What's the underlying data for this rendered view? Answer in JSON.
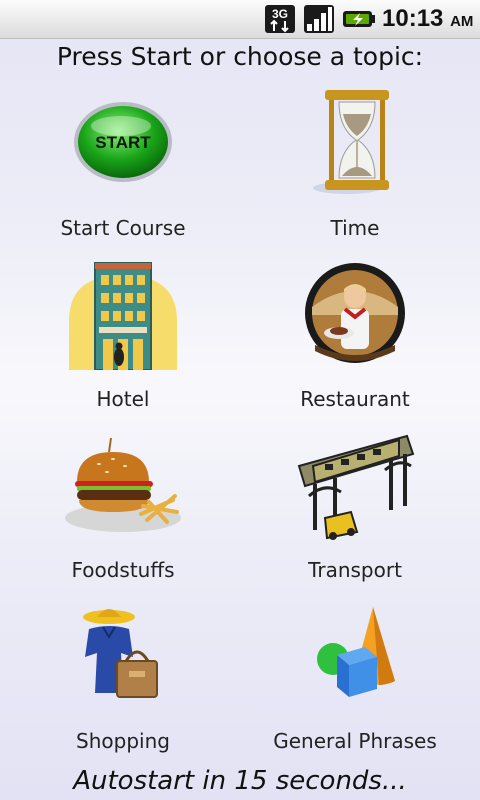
{
  "status_bar": {
    "network": "3G",
    "time": "10:13",
    "ampm": "AM",
    "icons": [
      "3g-data-icon",
      "signal-strength-icon",
      "battery-charging-icon"
    ]
  },
  "prompt": "Press Start or choose a topic:",
  "topics": [
    {
      "label": "Start Course",
      "icon": "start-button-icon"
    },
    {
      "label": "Time",
      "icon": "hourglass-icon"
    },
    {
      "label": "Hotel",
      "icon": "hotel-icon"
    },
    {
      "label": "Restaurant",
      "icon": "waiter-icon"
    },
    {
      "label": "Foodstuffs",
      "icon": "burger-fries-icon"
    },
    {
      "label": "Transport",
      "icon": "train-bridge-icon"
    },
    {
      "label": "Shopping",
      "icon": "shopping-icon"
    },
    {
      "label": "General Phrases",
      "icon": "shapes-icon"
    }
  ],
  "autostart": "Autostart in 15 seconds..."
}
